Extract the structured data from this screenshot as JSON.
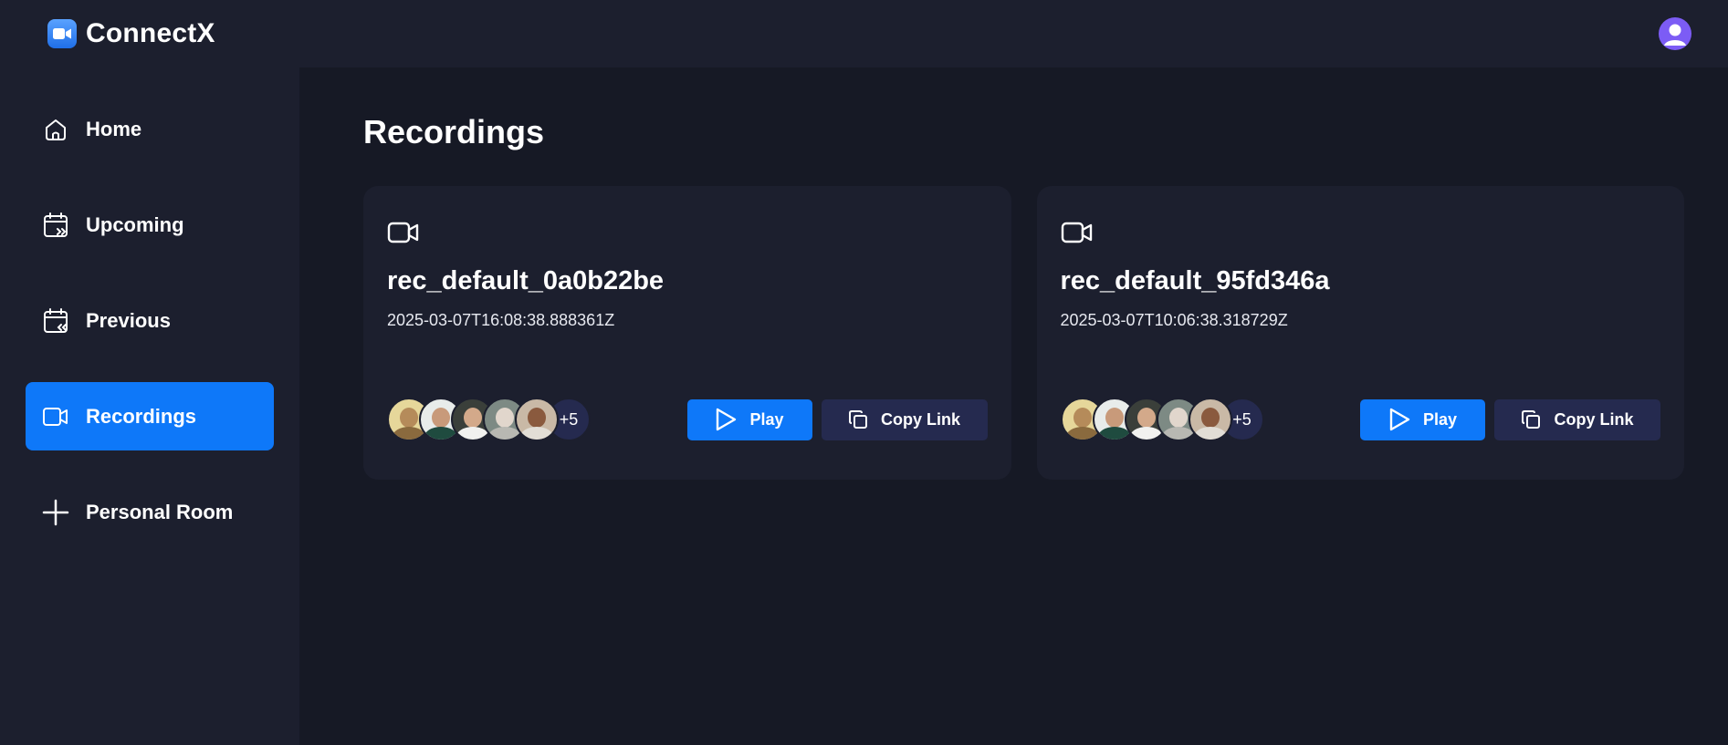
{
  "app": {
    "name": "ConnectX",
    "icons": {
      "logo": "video-camera-icon",
      "user": "user-avatar-icon"
    },
    "colors": {
      "accent": "#0e78f9",
      "surface": "#1c1f2e",
      "background": "#161925",
      "secondary_button": "#252a4f"
    }
  },
  "sidebar": {
    "items": [
      {
        "label": "Home",
        "icon": "home-icon",
        "active": false
      },
      {
        "label": "Upcoming",
        "icon": "calendar-upcoming-icon",
        "active": false
      },
      {
        "label": "Previous",
        "icon": "calendar-previous-icon",
        "active": false
      },
      {
        "label": "Recordings",
        "icon": "video-icon",
        "active": true
      },
      {
        "label": "Personal Room",
        "icon": "plus-icon",
        "active": false
      }
    ]
  },
  "main": {
    "title": "Recordings",
    "recordings": [
      {
        "title": "rec_default_0a0b22be",
        "date": "2025-03-07T16:08:38.888361Z",
        "extra_attendees": "+5",
        "play_label": "Play",
        "copy_label": "Copy Link"
      },
      {
        "title": "rec_default_95fd346a",
        "date": "2025-03-07T10:06:38.318729Z",
        "extra_attendees": "+5",
        "play_label": "Play",
        "copy_label": "Copy Link"
      }
    ]
  }
}
